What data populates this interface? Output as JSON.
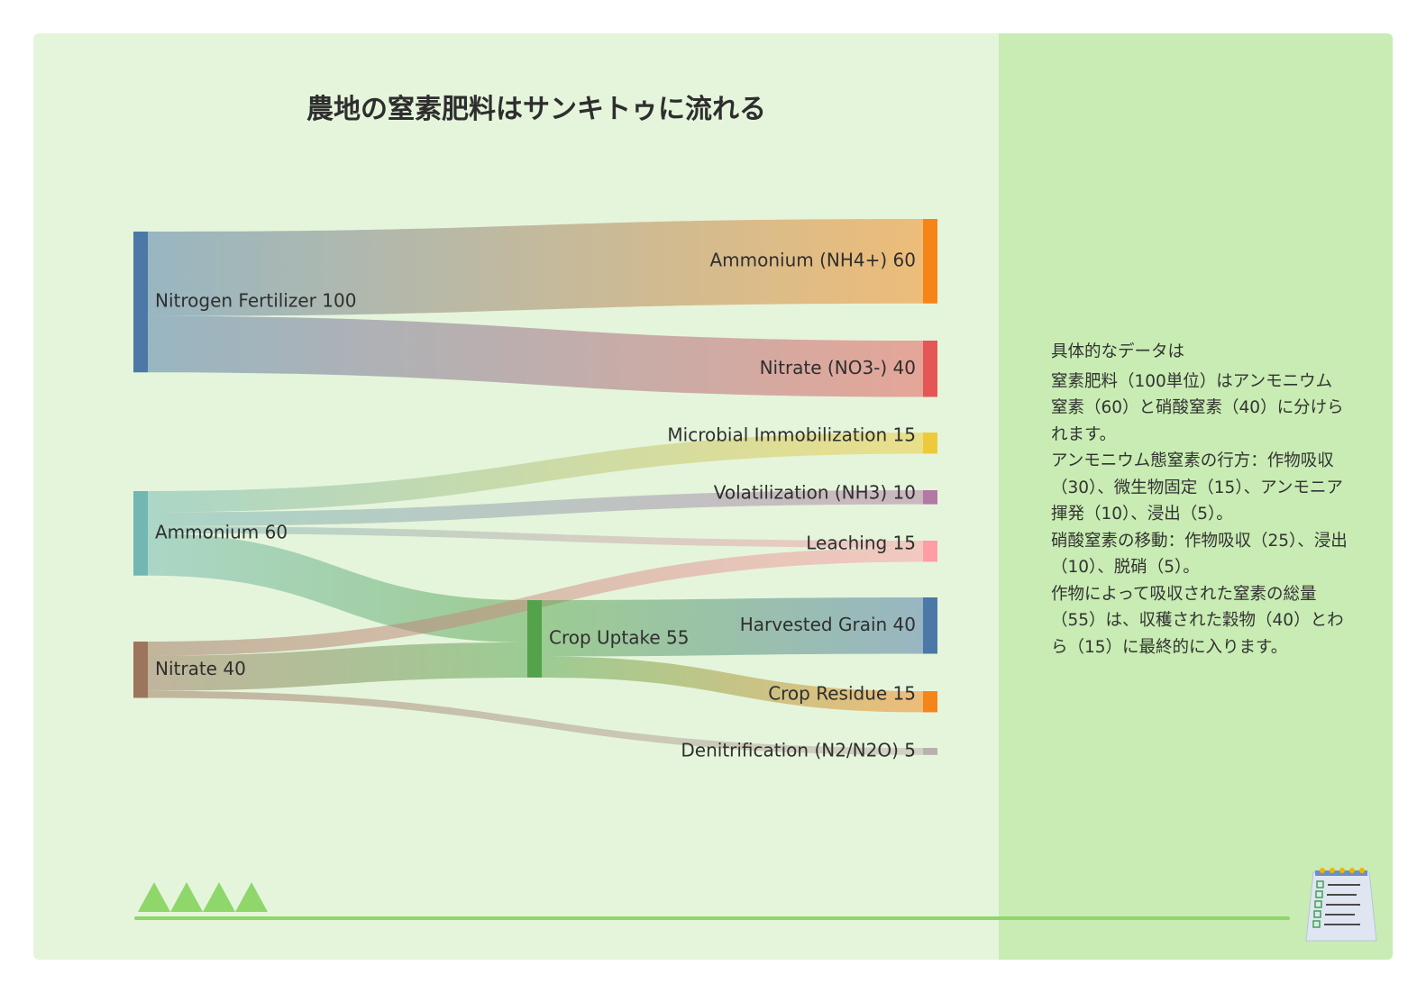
{
  "title": "農地の窒素肥料はサンキトゥに流れる",
  "colors": {
    "background": "#e5f5db",
    "panel": "#c8ecb3",
    "accent": "#8fd66b"
  },
  "chart_data": {
    "type": "sankey",
    "nodes": [
      {
        "id": "fert",
        "label": "Nitrogen Fertilizer 100",
        "value": 100,
        "color": "#4c78a8"
      },
      {
        "id": "amm",
        "label": "Ammonium (NH4+) 60",
        "value": 60,
        "color": "#f58518"
      },
      {
        "id": "nit",
        "label": "Nitrate (NO3-) 40",
        "value": 40,
        "color": "#e45756"
      },
      {
        "id": "mic",
        "label": "Microbial Immobilization 15",
        "value": 15,
        "color": "#eeca3b"
      },
      {
        "id": "vol",
        "label": "Volatilization (NH3) 10",
        "value": 10,
        "color": "#b279a2"
      },
      {
        "id": "lea",
        "label": "Leaching 15",
        "value": 15,
        "color": "#ff9da6"
      },
      {
        "id": "har",
        "label": "Harvested Grain 40",
        "value": 40,
        "color": "#4c78a8"
      },
      {
        "id": "res",
        "label": "Crop Residue 15",
        "value": 15,
        "color": "#f58518"
      },
      {
        "id": "den",
        "label": "Denitrification (N2/N2O) 5",
        "value": 5,
        "color": "#bab0ac"
      },
      {
        "id": "amm2",
        "label": "Ammonium 60",
        "value": 60,
        "color": "#72b7b2"
      },
      {
        "id": "nit2",
        "label": "Nitrate 40",
        "value": 40,
        "color": "#9d755d"
      },
      {
        "id": "crop",
        "label": "Crop Uptake 55",
        "value": 55,
        "color": "#54a24b"
      }
    ],
    "links": [
      {
        "source": "fert",
        "target": "amm",
        "value": 60
      },
      {
        "source": "fert",
        "target": "nit",
        "value": 40
      },
      {
        "source": "amm2",
        "target": "mic",
        "value": 15
      },
      {
        "source": "amm2",
        "target": "vol",
        "value": 10
      },
      {
        "source": "amm2",
        "target": "lea",
        "value": 5
      },
      {
        "source": "amm2",
        "target": "crop",
        "value": 30
      },
      {
        "source": "nit2",
        "target": "lea",
        "value": 10
      },
      {
        "source": "nit2",
        "target": "crop",
        "value": 25
      },
      {
        "source": "nit2",
        "target": "den",
        "value": 5
      },
      {
        "source": "crop",
        "target": "har",
        "value": 40
      },
      {
        "source": "crop",
        "target": "res",
        "value": 15
      }
    ]
  },
  "description": {
    "heading": "具体的なデータは",
    "lines": [
      "窒素肥料（100単位）はアンモニウム窒素（60）と硝酸窒素（40）に分けられます。",
      "アンモニウム態窒素の行方：作物吸収（30）、微生物固定（15）、アンモニア揮発（10）、浸出（5）。",
      "硝酸窒素の移動：作物吸収（25）、浸出（10）、脱硝（5）。",
      "作物によって吸収された窒素の総量（55）は、収穫された穀物（40）とわら（15）に最終的に入ります。"
    ]
  },
  "icons": {
    "triangles": "mountain-triangles-icon",
    "notepad": "checklist-notepad-icon"
  }
}
